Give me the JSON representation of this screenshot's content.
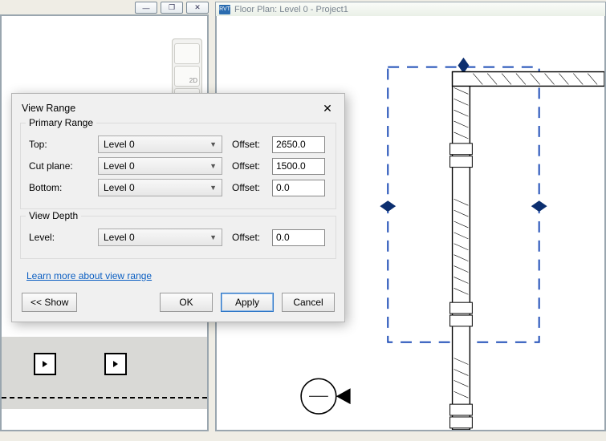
{
  "left_window": {
    "controls": {
      "min": "—",
      "max": "❐",
      "close": "✕"
    }
  },
  "right_window": {
    "badge": "RVT",
    "title": "Floor Plan: Level 0 - Project1"
  },
  "toolbar2d": {
    "label": "2D"
  },
  "dialog": {
    "title": "View Range",
    "close": "✕",
    "primary_range": {
      "legend": "Primary Range",
      "rows": {
        "top": {
          "label": "Top:",
          "value": "Level 0",
          "offset_label": "Offset:",
          "offset": "2650.0"
        },
        "cut": {
          "label": "Cut plane:",
          "value": "Level 0",
          "offset_label": "Offset:",
          "offset": "1500.0"
        },
        "bottom": {
          "label": "Bottom:",
          "value": "Level 0",
          "offset_label": "Offset:",
          "offset": "0.0"
        }
      }
    },
    "view_depth": {
      "legend": "View Depth",
      "row": {
        "label": "Level:",
        "value": "Level 0",
        "offset_label": "Offset:",
        "offset": "0.0"
      }
    },
    "link": "Learn more about view range",
    "buttons": {
      "show": "<< Show",
      "ok": "OK",
      "apply": "Apply",
      "cancel": "Cancel"
    }
  }
}
